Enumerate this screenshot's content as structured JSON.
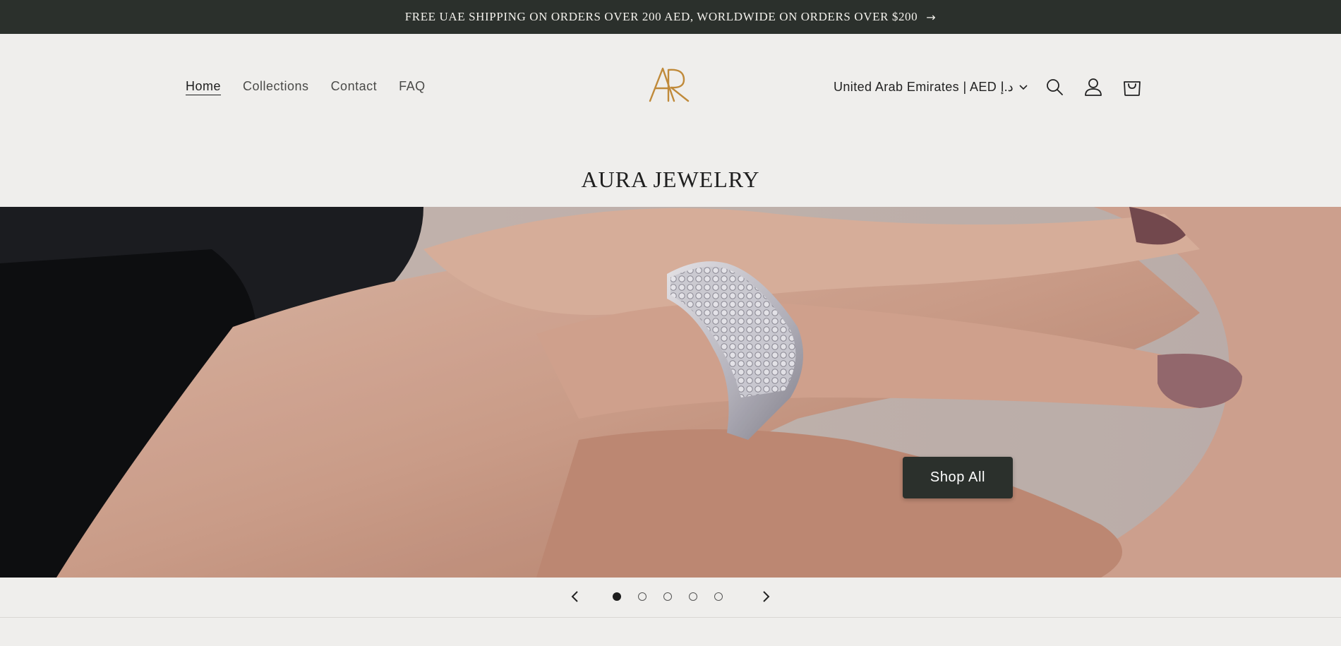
{
  "announcement": {
    "text": "FREE UAE SHIPPING ON ORDERS OVER 200 AED, WORLDWIDE ON ORDERS OVER $200",
    "arrow": "→"
  },
  "nav": {
    "items": [
      {
        "label": "Home",
        "active": true
      },
      {
        "label": "Collections"
      },
      {
        "label": "Contact"
      },
      {
        "label": "FAQ"
      }
    ]
  },
  "logo": {
    "letters": "AR",
    "color": "#c08a3a"
  },
  "header": {
    "country_selector": "United Arab Emirates | AED د.إ",
    "icons": [
      "search-icon",
      "account-icon",
      "cart-icon"
    ]
  },
  "brand": {
    "title": "AURA JEWELRY"
  },
  "hero": {
    "cta_label": "Shop All",
    "slides_total": 5,
    "active_slide": 1
  },
  "colors": {
    "dark": "#2b302c",
    "background": "#efeeec",
    "accent_gold": "#c08a3a"
  }
}
